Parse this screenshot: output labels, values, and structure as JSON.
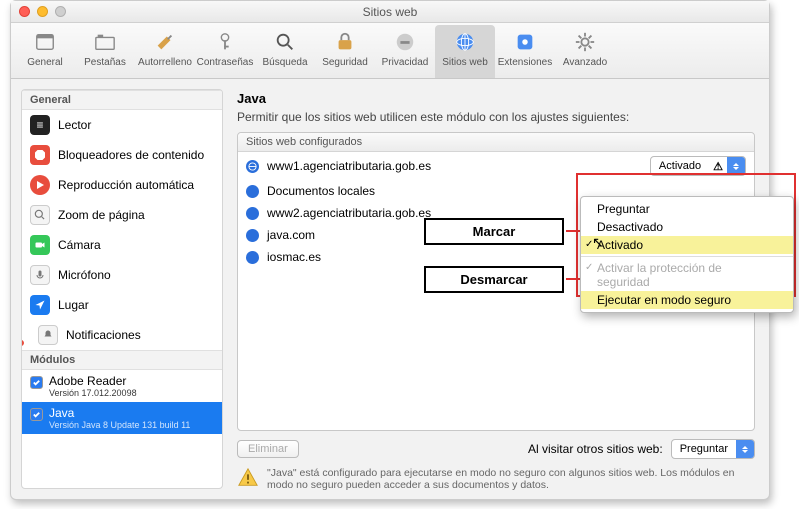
{
  "window": {
    "title": "Sitios web"
  },
  "toolbar": {
    "items": [
      {
        "label": "General"
      },
      {
        "label": "Pestañas"
      },
      {
        "label": "Autorrelleno"
      },
      {
        "label": "Contraseñas"
      },
      {
        "label": "Búsqueda"
      },
      {
        "label": "Seguridad"
      },
      {
        "label": "Privacidad"
      },
      {
        "label": "Sitios web"
      },
      {
        "label": "Extensiones"
      },
      {
        "label": "Avanzado"
      }
    ]
  },
  "sidebar": {
    "header_general": "General",
    "items": [
      {
        "label": "Lector",
        "color": "#222"
      },
      {
        "label": "Bloqueadores de contenido",
        "color": "#e84d3d"
      },
      {
        "label": "Reproducción automática",
        "color": "#e84d3d"
      },
      {
        "label": "Zoom de página",
        "color": "#e8e8e8"
      },
      {
        "label": "Cámara",
        "color": "#35c759"
      },
      {
        "label": "Micrófono",
        "color": "#e8e8e8"
      },
      {
        "label": "Lugar",
        "color": "#1a7bf0"
      },
      {
        "label": "Notificaciones",
        "color": "#e8e8e8"
      }
    ],
    "header_modules": "Módulos",
    "modules": [
      {
        "name": "Adobe Reader",
        "ver": "Versión 17.012.20098"
      },
      {
        "name": "Java",
        "ver": "Versión Java 8 Update 131 build 11"
      }
    ]
  },
  "main": {
    "title": "Java",
    "subtitle": "Permitir que los sitios web utilicen este módulo con los ajustes siguientes:",
    "list_header": "Sitios web configurados",
    "rows": [
      {
        "site": "www1.agenciatributaria.gob.es",
        "value": "Activado",
        "show_sel": true
      },
      {
        "site": "Documentos locales"
      },
      {
        "site": "www2.agenciatributaria.gob.es"
      },
      {
        "site": "java.com"
      },
      {
        "site": "iosmac.es"
      }
    ],
    "delete_btn": "Eliminar",
    "other_label": "Al visitar otros sitios web:",
    "other_value": "Preguntar",
    "warning": "\"Java\" está configurado para ejecutarse en modo no seguro con algunos sitios web. Los módulos en modo no seguro pueden acceder a sus documentos y datos."
  },
  "popup": {
    "items": {
      "ask": "Preguntar",
      "off": "Desactivado",
      "on": "Activado",
      "protect": "Activar la protección de seguridad",
      "safe": "Ejecutar en modo seguro"
    }
  },
  "annot": {
    "mark": "Marcar",
    "unmark": "Desmarcar"
  }
}
